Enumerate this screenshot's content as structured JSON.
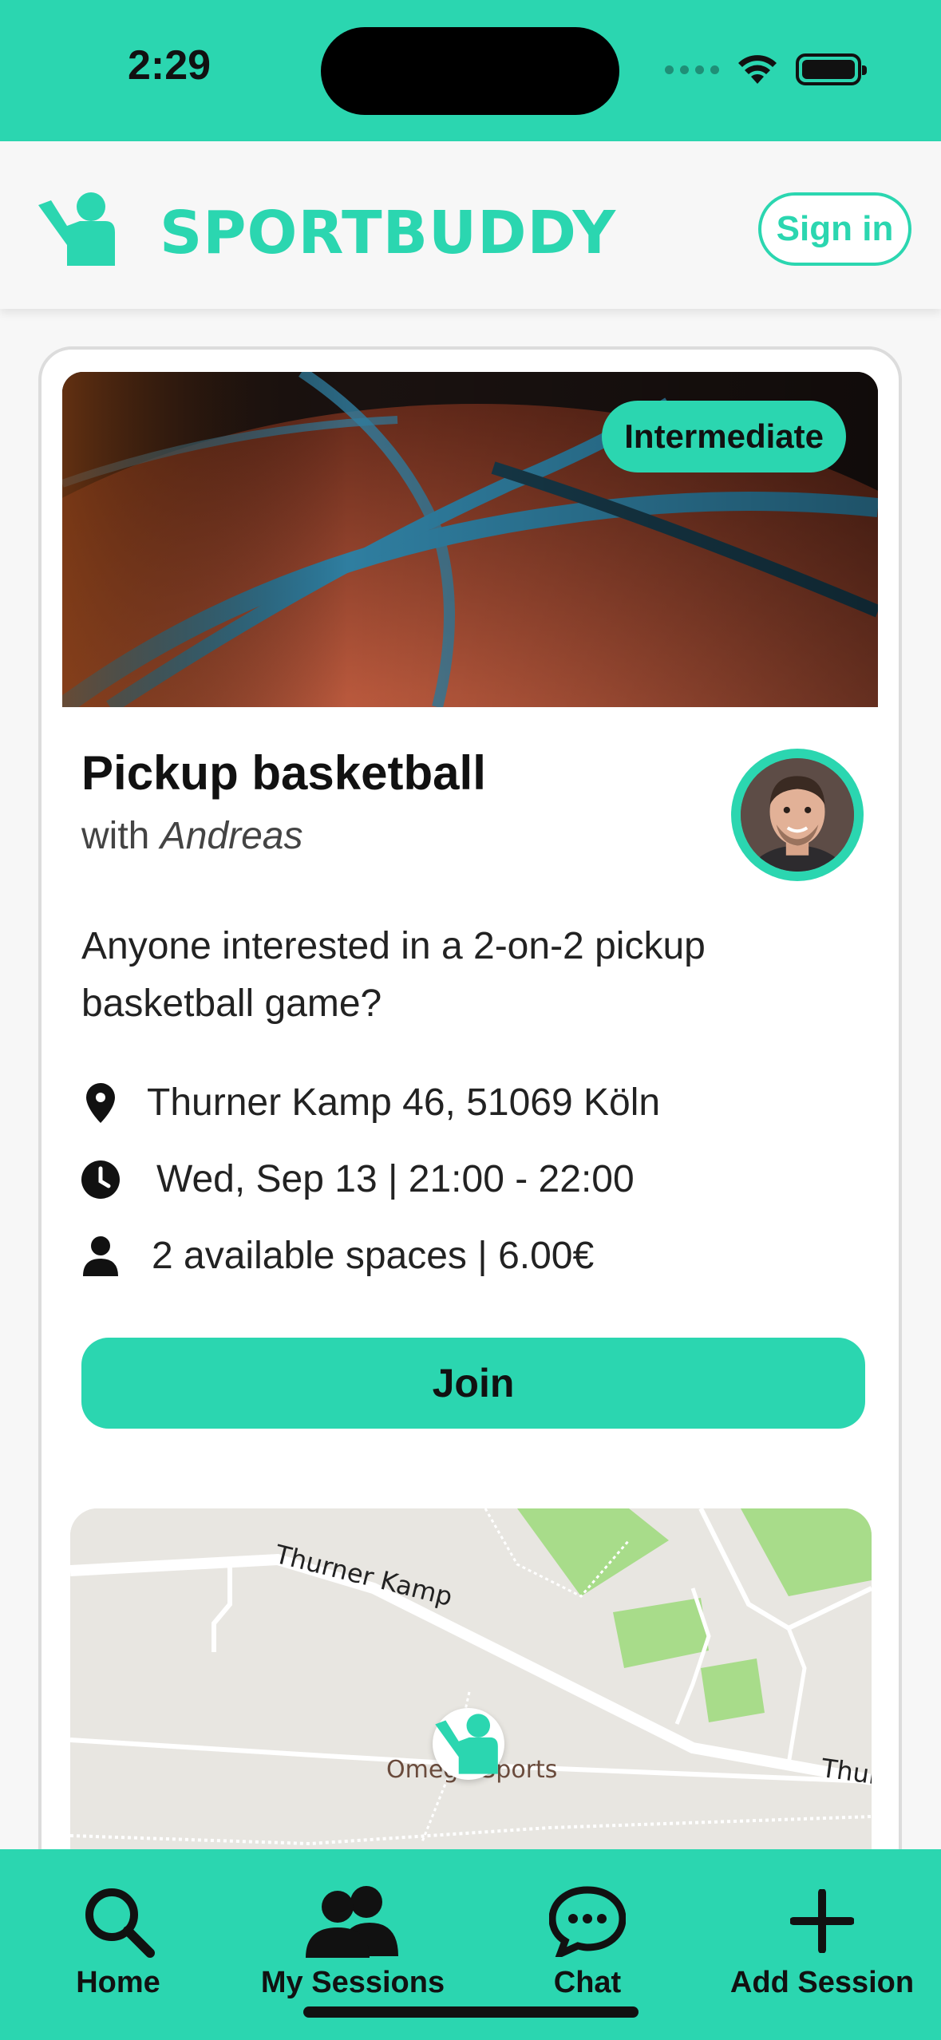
{
  "status_bar": {
    "time": "2:29"
  },
  "header": {
    "brand": "SPORTBUDDY",
    "signin_label": "Sign in"
  },
  "session": {
    "level": "Intermediate",
    "title": "Pickup basketball",
    "host_prefix": "with",
    "host_name": "Andreas",
    "description": "Anyone interested in a 2-on-2 pickup basketball game?",
    "address": "Thurner Kamp 46, 51069 Köln",
    "datetime": "Wed, Sep 13 | 21:00 - 22:00",
    "spaces": "2 available spaces | 6.00€",
    "join_label": "Join"
  },
  "map": {
    "street_1": "Thurner Kamp",
    "street_2": "Thur",
    "poi": "Omega Sports"
  },
  "tabs": [
    {
      "label": "Home",
      "icon": "search-icon"
    },
    {
      "label": "My Sessions",
      "icon": "users-icon"
    },
    {
      "label": "Chat",
      "icon": "chat-icon"
    },
    {
      "label": "Add Session",
      "icon": "plus-icon"
    }
  ],
  "colors": {
    "accent": "#2bd6b0",
    "text": "#111111",
    "background": "#f7f7f7"
  }
}
